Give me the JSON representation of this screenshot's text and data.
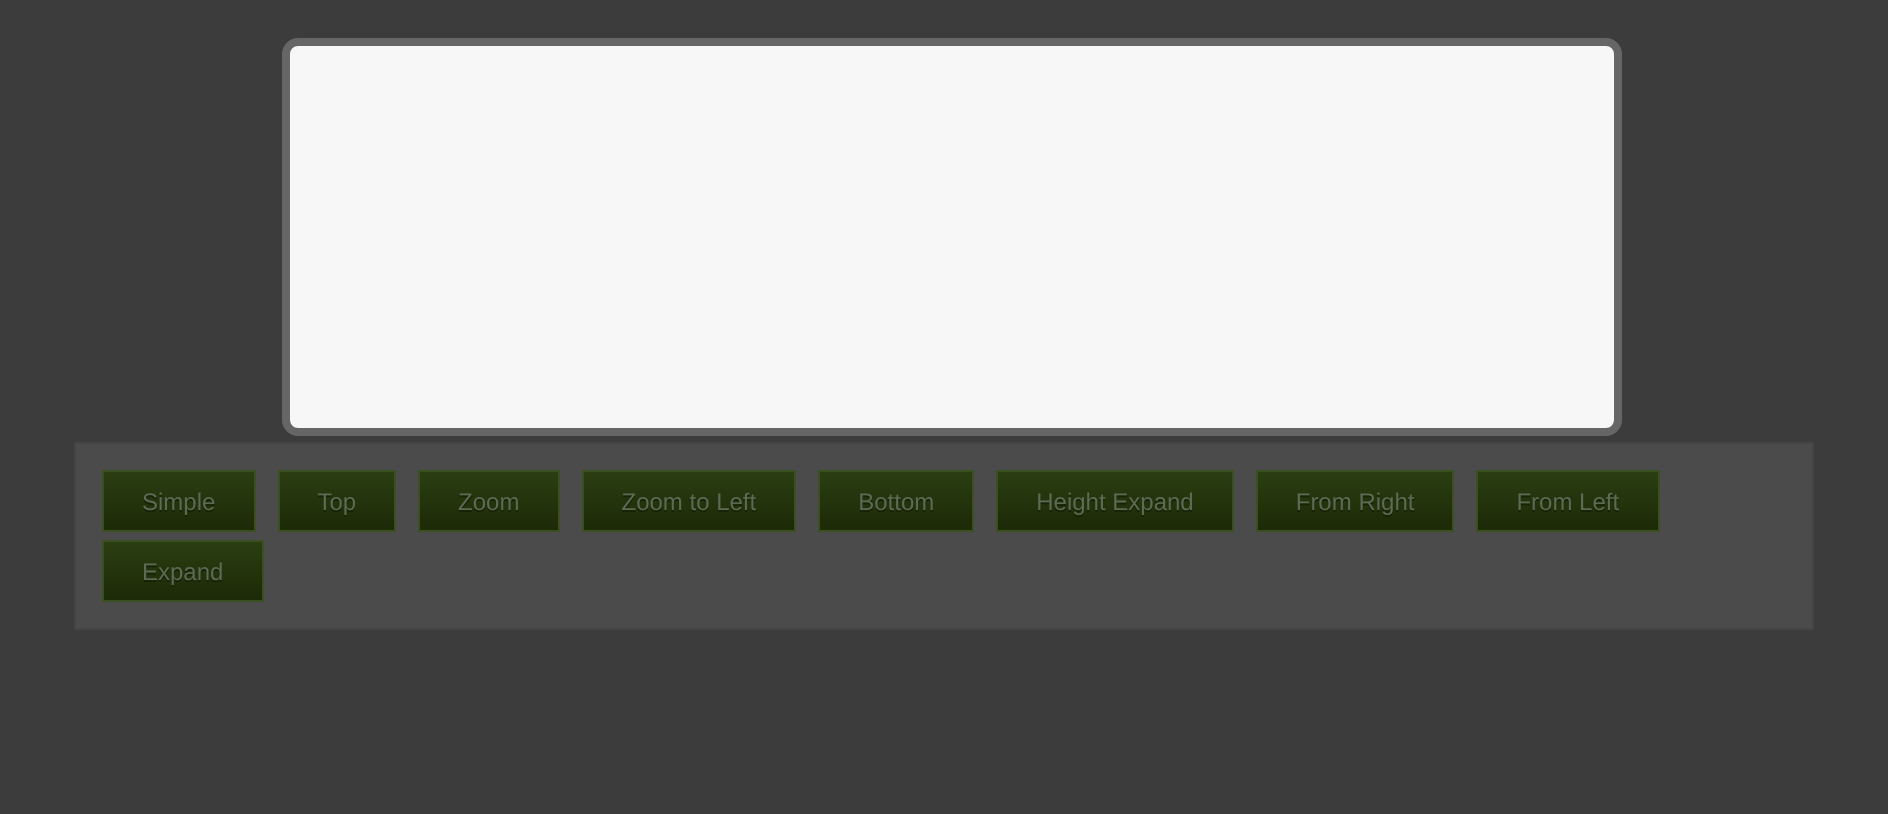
{
  "buttons": [
    {
      "label": "Simple"
    },
    {
      "label": "Top"
    },
    {
      "label": "Zoom"
    },
    {
      "label": "Zoom to Left"
    },
    {
      "label": "Bottom"
    },
    {
      "label": "Height Expand"
    },
    {
      "label": "From Right"
    },
    {
      "label": "From Left"
    },
    {
      "label": "Expand"
    }
  ]
}
